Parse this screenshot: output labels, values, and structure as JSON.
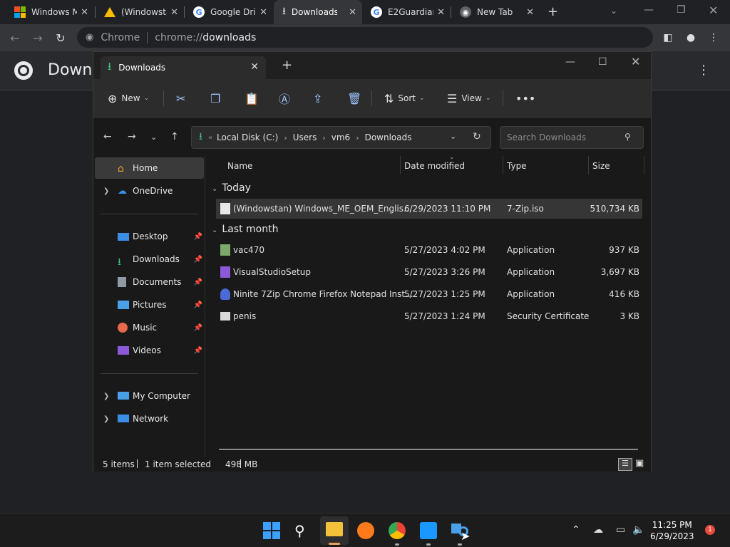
{
  "browser": {
    "tabs": [
      {
        "title": "Windows M",
        "icon": "windows-logo-icon"
      },
      {
        "title": "(Windowsta",
        "icon": "google-drive-icon"
      },
      {
        "title": "Google Dri",
        "icon": "google-icon"
      },
      {
        "title": "Downloads",
        "icon": "download-icon",
        "active": true
      },
      {
        "title": "E2Guardian",
        "icon": "google-icon"
      },
      {
        "title": "New Tab",
        "icon": "chrome-icon"
      }
    ],
    "new_tab_symbol": "+",
    "omnibox": {
      "site_label": "Chrome",
      "url_prefix": "chrome://",
      "url_path": "downloads"
    },
    "page_title": "Downl"
  },
  "explorer": {
    "tab_title": "Downloads",
    "commands": {
      "new_label": "New",
      "sort_label": "Sort",
      "view_label": "View"
    },
    "breadcrumb": [
      "Local Disk (C:)",
      "Users",
      "vm6",
      "Downloads"
    ],
    "search_placeholder": "Search Downloads",
    "nav": {
      "home": "Home",
      "onedrive": "OneDrive",
      "desktop": "Desktop",
      "downloads": "Downloads",
      "documents": "Documents",
      "pictures": "Pictures",
      "music": "Music",
      "videos": "Videos",
      "mycomputer": "My Computer",
      "network": "Network"
    },
    "columns": {
      "name": "Name",
      "date": "Date modified",
      "type": "Type",
      "size": "Size"
    },
    "groups": {
      "today": "Today",
      "last_month": "Last month"
    },
    "files": [
      {
        "name": "(Windowstan) Windows_ME_OEM_Englis...",
        "date": "6/29/2023 11:10 PM",
        "type": "7-Zip.iso",
        "size": "510,734 KB",
        "selected": true
      },
      {
        "name": "vac470",
        "date": "5/27/2023 4:02 PM",
        "type": "Application",
        "size": "937 KB"
      },
      {
        "name": "VisualStudioSetup",
        "date": "5/27/2023 3:26 PM",
        "type": "Application",
        "size": "3,697 KB"
      },
      {
        "name": "Ninite 7Zip Chrome Firefox Notepad Inst...",
        "date": "5/27/2023 1:25 PM",
        "type": "Application",
        "size": "416 KB"
      },
      {
        "name": "penis",
        "date": "5/27/2023 1:24 PM",
        "type": "Security Certificate",
        "size": "3 KB"
      }
    ],
    "status": {
      "items": "5 items",
      "selected": "1 item selected",
      "size": "498 MB"
    }
  },
  "taskbar": {
    "time": "11:25 PM",
    "date": "6/29/2023",
    "notification_count": "1"
  }
}
